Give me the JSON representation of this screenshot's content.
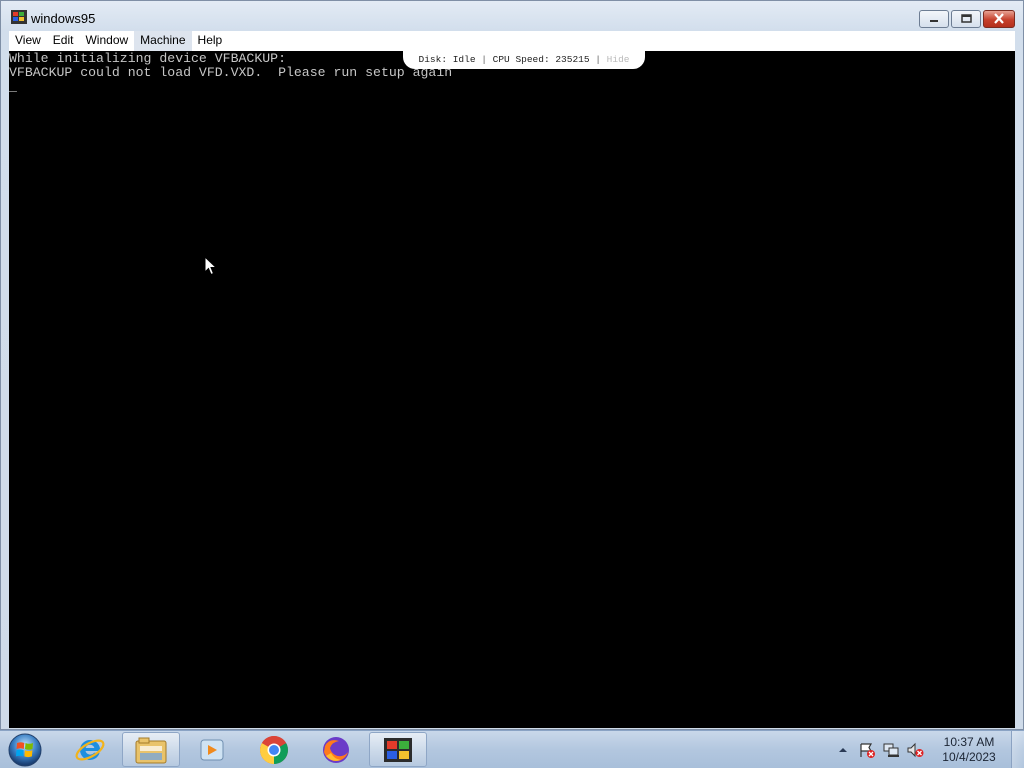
{
  "window": {
    "title": "windows95",
    "app_icon": "windows95-flag-icon"
  },
  "menu": {
    "items": [
      "View",
      "Edit",
      "Window",
      "Machine",
      "Help"
    ],
    "active": "Machine"
  },
  "status": {
    "disk": "Disk: Idle",
    "cpu": "CPU Speed: 235215",
    "hide": "Hide",
    "separator": "|"
  },
  "console": {
    "lines": [
      "While initializing device VFBACKUP:",
      "VFBACKUP could not load VFD.VXD.  Please run setup again",
      "_"
    ],
    "text_color": "#c6c6c6",
    "background": "#000000"
  },
  "taskbar": {
    "start": "windows-start-orb-icon",
    "apps": [
      {
        "name": "internet-explorer-icon",
        "active": false
      },
      {
        "name": "file-explorer-icon",
        "active": true
      },
      {
        "name": "media-player-icon",
        "active": false
      },
      {
        "name": "chrome-icon",
        "active": false
      },
      {
        "name": "firefox-icon",
        "active": false
      },
      {
        "name": "windows95-app-icon",
        "active": true
      }
    ],
    "tray_icons": [
      "show-hidden-icons-arrow",
      "action-center-flag-icon",
      "network-icon",
      "volume-muted-icon"
    ]
  },
  "clock": {
    "time": "10:37 AM",
    "date": "10/4/2023"
  }
}
